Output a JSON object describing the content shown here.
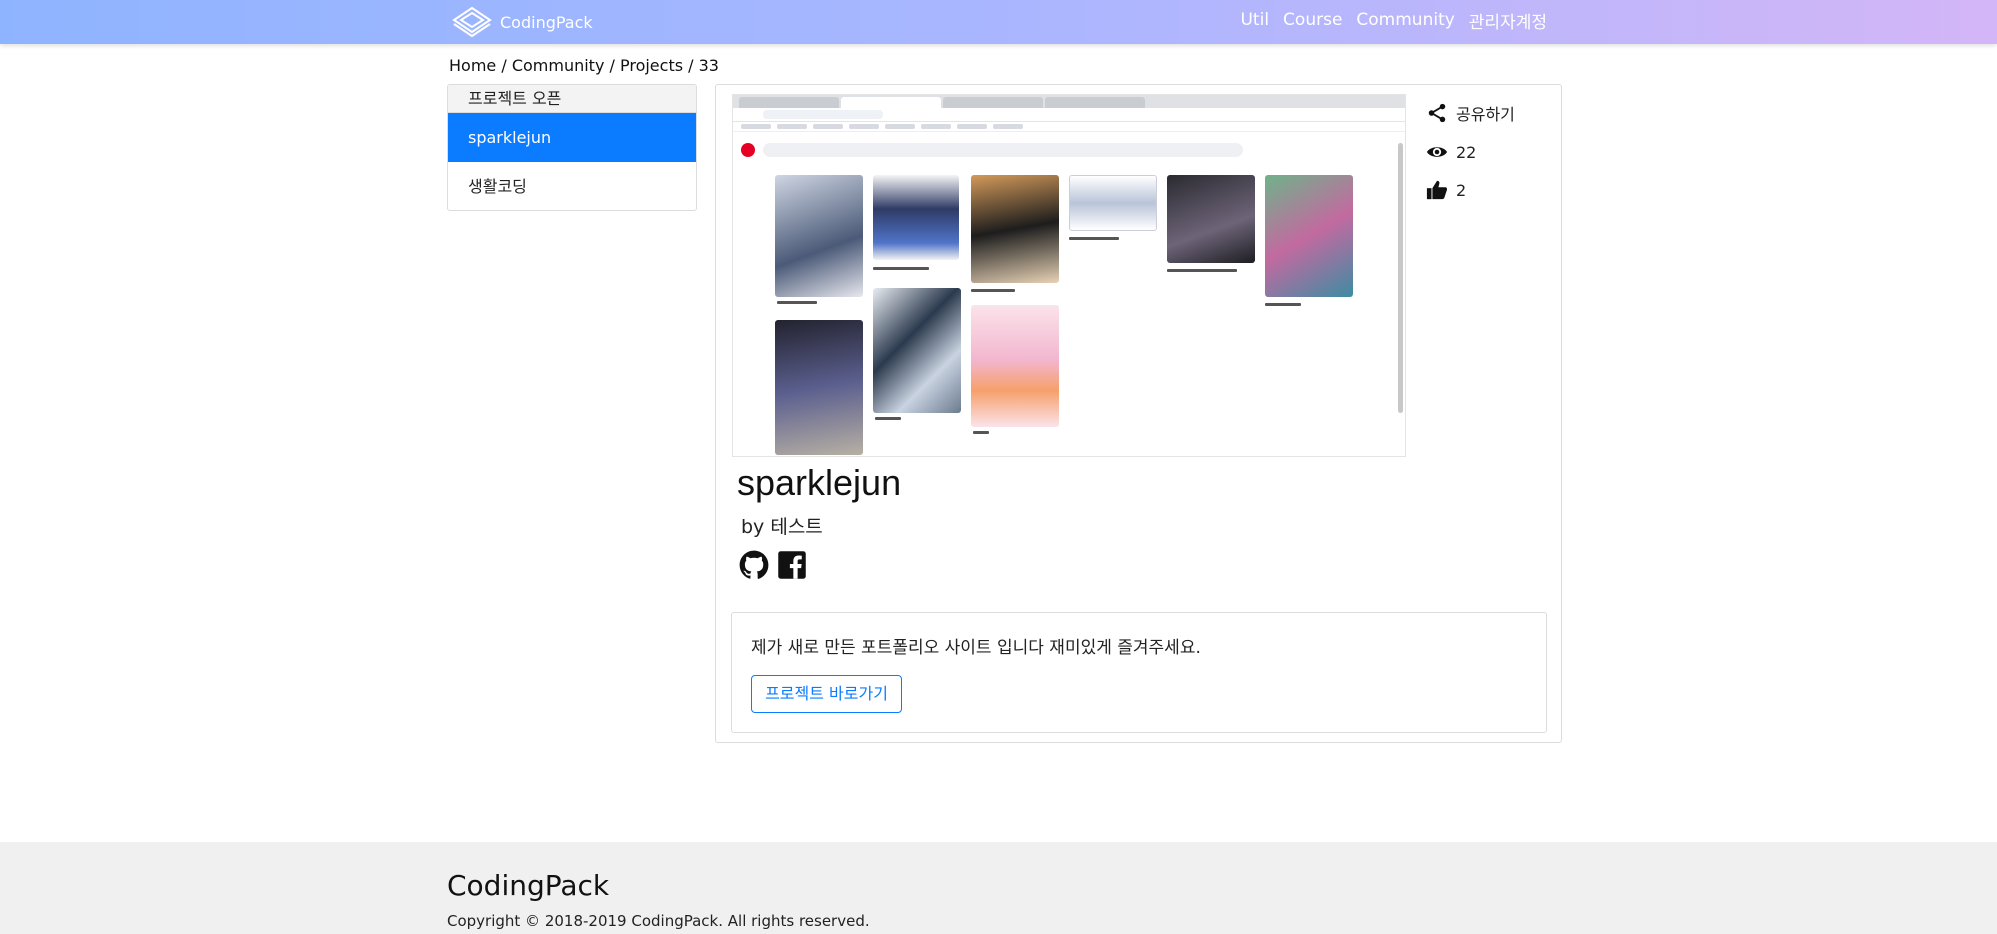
{
  "navbar": {
    "brand": "CodingPack",
    "links": [
      "Util",
      "Course",
      "Community",
      "관리자계정"
    ]
  },
  "breadcrumb": "Home / Community / Projects / 33",
  "sidebar": {
    "header": "프로젝트 오픈",
    "items": [
      {
        "label": "sparklejun",
        "active": true
      },
      {
        "label": "생활코딩",
        "active": false
      }
    ]
  },
  "project": {
    "title": "sparklejun",
    "author": "by 테스트",
    "description": "제가 새로 만든 포트폴리오 사이트 입니다 재미있게 즐겨주세요.",
    "goto_label": "프로젝트 바로가기",
    "share_label": "공유하기",
    "views": "22",
    "likes": "2",
    "social_icons": [
      "github-icon",
      "facebook-icon"
    ]
  },
  "footer": {
    "brand": "CodingPack",
    "copyright": "Copyright © 2018-2019 CodingPack. All rights reserved."
  },
  "colors": {
    "nav_gradient_start": "#8fb4ff",
    "nav_gradient_end": "#d3b6f7",
    "primary": "#0b7cff",
    "footer_bg": "#f0f0f0"
  }
}
